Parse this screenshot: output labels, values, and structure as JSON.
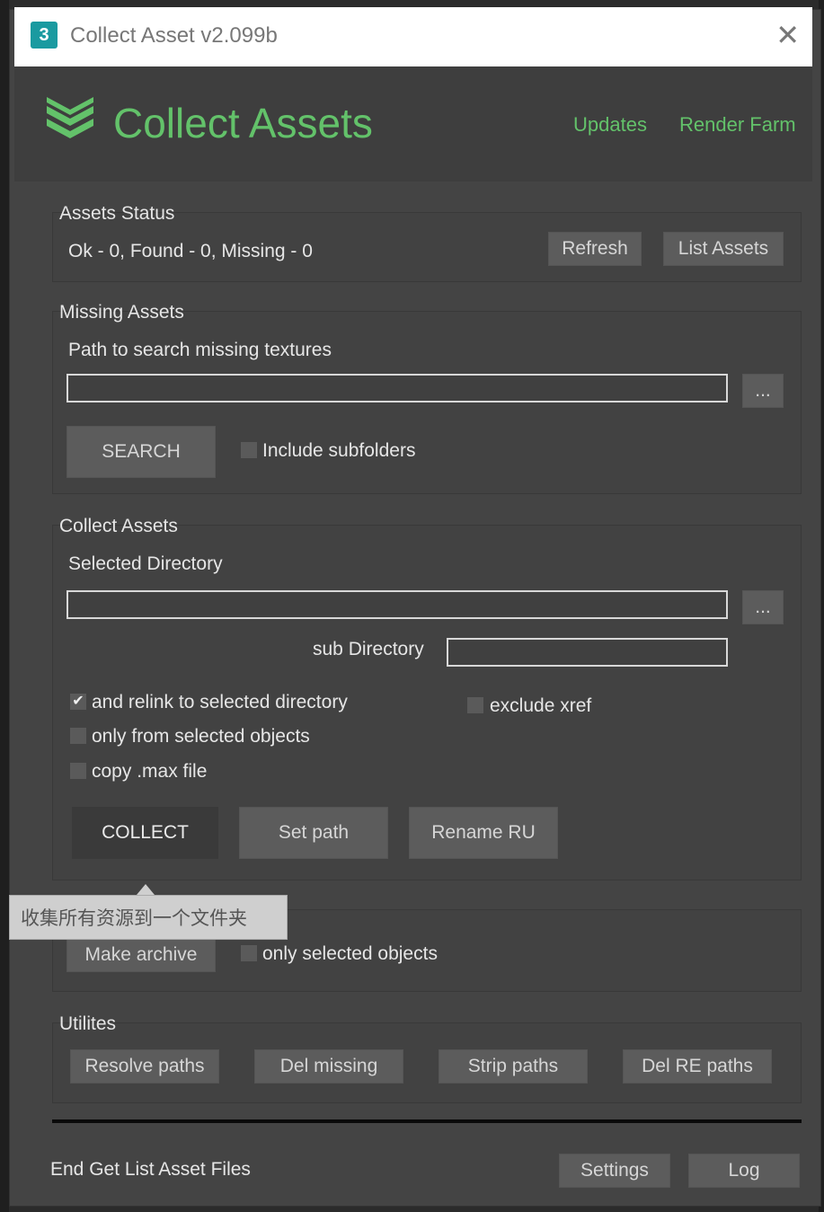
{
  "window": {
    "title": "Collect Asset v2.099b",
    "app_badge": "3",
    "close_label": "✕"
  },
  "header": {
    "logo_text": "Collect Assets",
    "links": [
      "Updates",
      "Render Farm"
    ],
    "accent_color": "#63c26a"
  },
  "assets_status": {
    "label": "Assets Status",
    "status_text": "Ok - 0, Found - 0, Missing - 0",
    "refresh_button": "Refresh",
    "list_assets_button": "List Assets"
  },
  "missing_assets": {
    "label": "Missing Assets",
    "path_label": "Path to search missing textures",
    "path_value": "",
    "browse_button": "...",
    "search_button": "SEARCH",
    "include_subfolders_label": "Include subfolders",
    "include_subfolders_checked": false
  },
  "collect_assets": {
    "label": "Collect Assets",
    "selected_dir_label": "Selected Directory",
    "selected_dir_value": "",
    "browse_button": "...",
    "sub_dir_label": "sub Directory",
    "sub_dir_value": "",
    "relink_label": "and relink to selected directory",
    "relink_checked": true,
    "relink_check_glyph": "✔",
    "exclude_xref_label": "exclude xref",
    "only_selected_label": "only from selected objects",
    "copy_max_label": "copy .max file",
    "collect_button": "COLLECT",
    "set_path_button": "Set path",
    "rename_ru_button": "Rename RU"
  },
  "tooltip": {
    "text": "收集所有资源到一个文件夹"
  },
  "archive": {
    "make_archive_button": "Make archive",
    "only_selected_label": "only selected objects"
  },
  "utilities": {
    "label": "Utilites",
    "buttons": [
      "Resolve paths",
      "Del missing",
      "Strip paths",
      "Del RE paths"
    ]
  },
  "footer": {
    "status_text": "End Get List Asset Files",
    "settings_button": "Settings",
    "log_button": "Log"
  }
}
